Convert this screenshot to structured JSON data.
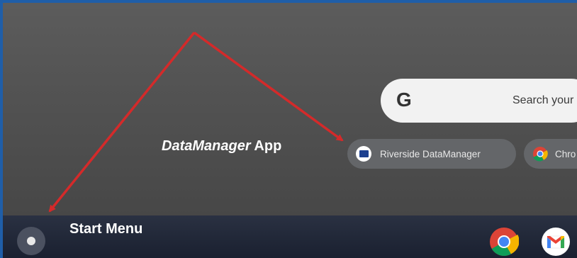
{
  "annotations": {
    "app_label_italic": "DataManager",
    "app_label_rest": " App",
    "start_menu_label": "Start Menu"
  },
  "search": {
    "logo": "G",
    "placeholder": "Search your"
  },
  "app_chips": [
    {
      "label": "Riverside DataManager",
      "icon": "datamanager-icon"
    },
    {
      "label": "Chro",
      "icon": "chrome-icon"
    }
  ],
  "shelf": {
    "launcher_icon": "launcher-icon",
    "apps": [
      "chrome-icon",
      "gmail-icon"
    ]
  },
  "colors": {
    "arrow": "#d42a2a",
    "frame_border": "#1f5ea8",
    "desktop": "#525252",
    "shelf": "#1f2535"
  }
}
